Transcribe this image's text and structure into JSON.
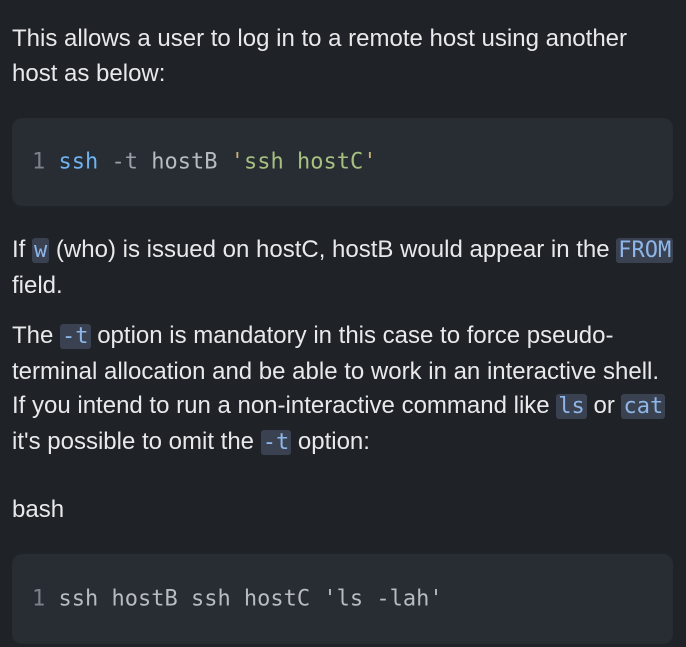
{
  "intro": {
    "text": "This allows a user to log in to a remote host using another host as below:"
  },
  "code_block_1": {
    "line_number": "1",
    "cmd": "ssh",
    "flag": "-t",
    "host": "hostB",
    "quote_open": "'",
    "str_inner": "ssh hostC",
    "quote_close": "'"
  },
  "para_who": {
    "prefix": "If ",
    "code_w": "w",
    "middle": " (who) is issued on hostC, hostB would appear in the ",
    "code_from": "FROM",
    "suffix": " field."
  },
  "para_option": {
    "prefix": "The ",
    "code_t": "-t",
    "text1": " option is mandatory in this case to force pseudo-terminal allocation and be able to work in an interactive shell. If you intend to run a non-interactive command like ",
    "code_ls": "ls",
    "text2": " or ",
    "code_cat": "cat",
    "text3": " it's possible to omit the ",
    "code_t2": "-t",
    "text4": " option:"
  },
  "lang_label": "bash",
  "code_block_2": {
    "line_number": "1",
    "code": "ssh hostB ssh hostC 'ls -lah'"
  }
}
